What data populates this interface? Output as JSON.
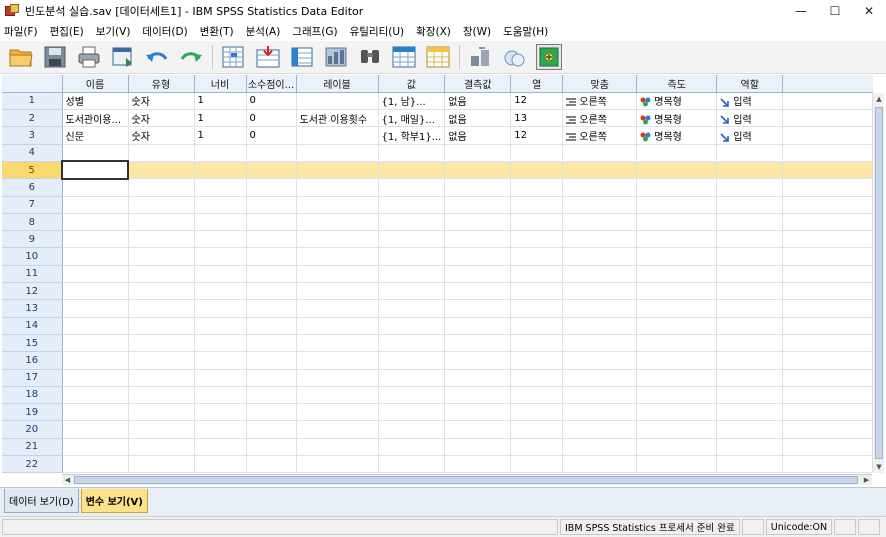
{
  "window": {
    "title": "빈도분석 실습.sav [데이터세트1] - IBM SPSS Statistics Data Editor",
    "minimize": "—",
    "maximize": "☐",
    "close": "✕"
  },
  "menu": [
    "파일(F)",
    "편집(E)",
    "보기(V)",
    "데이터(D)",
    "변환(T)",
    "분석(A)",
    "그래프(G)",
    "유틸리티(U)",
    "확장(X)",
    "창(W)",
    "도움말(H)"
  ],
  "toolbar_icons": [
    "open-folder-icon",
    "save-icon",
    "print-icon",
    "recall-dialog-icon",
    "undo-icon",
    "redo-icon",
    "goto-case-icon",
    "goto-variable-icon",
    "variables-icon",
    "run-descriptives-icon",
    "find-icon",
    "insert-cases-icon",
    "insert-variable-icon",
    "split-file-icon",
    "weight-cases-icon",
    "select-cases-icon",
    "value-labels-icon",
    "use-sets-icon"
  ],
  "columns": [
    "이름",
    "유형",
    "너비",
    "소수점이...",
    "레이블",
    "값",
    "결측값",
    "열",
    "맞춤",
    "측도",
    "역할"
  ],
  "rows": [
    {
      "num": "1",
      "cells": [
        "성별",
        "숫자",
        "1",
        "0",
        "",
        "{1, 남}...",
        "없음",
        "12",
        "오른쪽",
        "명목형",
        "입력"
      ]
    },
    {
      "num": "2",
      "cells": [
        "도서관이용...",
        "숫자",
        "1",
        "0",
        "도서관 이용횟수",
        "{1, 매일}...",
        "없음",
        "13",
        "오른쪽",
        "명목형",
        "입력"
      ]
    },
    {
      "num": "3",
      "cells": [
        "신문",
        "숫자",
        "1",
        "0",
        "",
        "{1, 학부1}...",
        "없음",
        "12",
        "오른쪽",
        "명목형",
        "입력"
      ]
    }
  ],
  "empty_rows": [
    "4",
    "5",
    "6",
    "7",
    "8",
    "9",
    "10",
    "11",
    "12",
    "13",
    "14",
    "15",
    "16",
    "17",
    "18",
    "19",
    "20",
    "21",
    "22"
  ],
  "highlight_row": "5",
  "tabs": {
    "data_view": "데이터 보기(D)",
    "variable_view": "변수 보기(V)"
  },
  "status": {
    "processor": "IBM SPSS Statistics 프로세서 준비 완료",
    "unicode": "Unicode:ON"
  },
  "colors": {
    "highlight_row": "#fde7a8",
    "active_tab": "#fce08a",
    "header_bg": "#eaf1fb"
  }
}
